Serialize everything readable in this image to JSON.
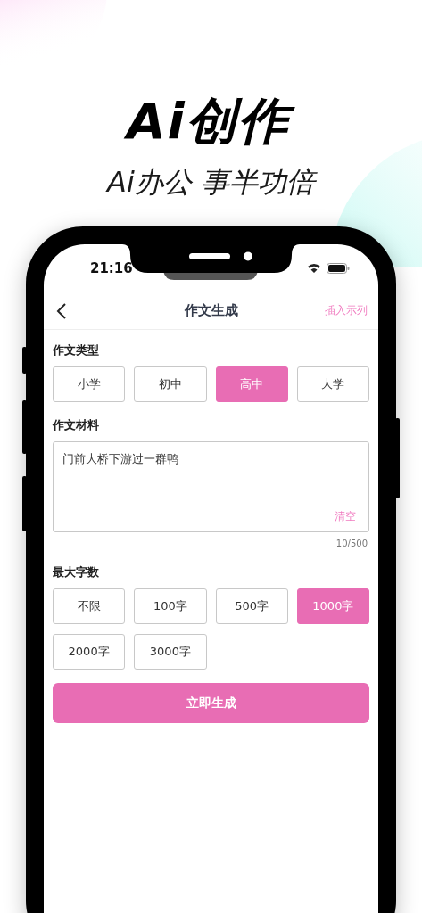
{
  "headline": "Ai创作",
  "tagline": "Ai办公 事半功倍",
  "status_bar": {
    "time": "21:16"
  },
  "nav": {
    "title": "作文生成",
    "action": "插入示列"
  },
  "sections": [
    {
      "kind": "options",
      "label": "作文类型",
      "options": [
        {
          "label": "小学",
          "selected": false
        },
        {
          "label": "初中",
          "selected": false
        },
        {
          "label": "高中",
          "selected": true
        },
        {
          "label": "大学",
          "selected": false
        }
      ]
    },
    {
      "kind": "textarea",
      "label": "作文材料",
      "value": "门前大桥下游过一群鸭",
      "clear": "清空",
      "count": "10/500"
    },
    {
      "kind": "options",
      "label": "最大字数",
      "options": [
        {
          "label": "不限",
          "selected": false
        },
        {
          "label": "100字",
          "selected": false
        },
        {
          "label": "500字",
          "selected": false
        },
        {
          "label": "1000字",
          "selected": true
        },
        {
          "label": "2000字",
          "selected": false
        },
        {
          "label": "3000字",
          "selected": false
        }
      ]
    }
  ],
  "submit": "立即生成"
}
